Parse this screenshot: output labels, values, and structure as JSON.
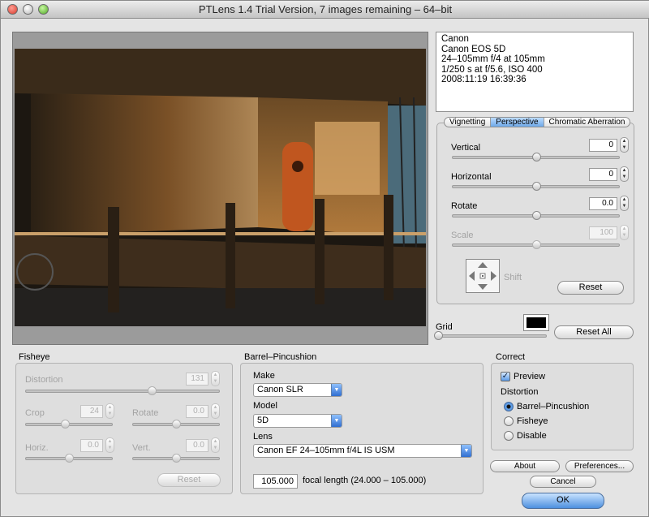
{
  "window": {
    "title": "PTLens 1.4 Trial Version, 7 images remaining – 64–bit"
  },
  "exif": [
    "Canon",
    "Canon EOS 5D",
    "24–105mm f/4 at 105mm",
    "1/250 s at f/5.6, ISO 400",
    "2008:11:19 16:39:36"
  ],
  "tabs": [
    {
      "label": "Vignetting",
      "active": false
    },
    {
      "label": "Perspective",
      "active": true
    },
    {
      "label": "Chromatic Aberration",
      "active": false
    }
  ],
  "perspective": {
    "vertical": {
      "label": "Vertical",
      "value": "0",
      "level": 0.5
    },
    "horizontal": {
      "label": "Horizontal",
      "value": "0",
      "level": 0.5
    },
    "rotate": {
      "label": "Rotate",
      "value": "0.0",
      "level": 0.5
    },
    "scale": {
      "label": "Scale",
      "value": "100",
      "level": 0.5
    },
    "shift_label": "Shift",
    "reset_label": "Reset"
  },
  "grid": {
    "label": "Grid",
    "level": 0.0,
    "color": "#000000"
  },
  "reset_all_label": "Reset All",
  "fisheye": {
    "title": "Fisheye",
    "distortion": {
      "label": "Distortion",
      "value": "131",
      "level": 0.65
    },
    "crop": {
      "label": "Crop",
      "value": "24",
      "level": 0.45
    },
    "rotate": {
      "label": "Rotate",
      "value": "0.0",
      "level": 0.5
    },
    "horiz": {
      "label": "Horiz.",
      "value": "0.0",
      "level": 0.5
    },
    "vert": {
      "label": "Vert.",
      "value": "0.0",
      "level": 0.5
    },
    "reset_label": "Reset"
  },
  "barrel": {
    "title": "Barrel–Pincushion",
    "make_label": "Make",
    "make_value": "Canon SLR",
    "model_label": "Model",
    "model_value": "5D",
    "lens_label": "Lens",
    "lens_value": "Canon EF 24–105mm f/4L IS USM",
    "focal_value": "105.000",
    "focal_label": "focal length (24.000 – 105.000)"
  },
  "correct": {
    "title": "Correct",
    "preview_label": "Preview",
    "distortion_label": "Distortion",
    "options": [
      "Barrel–Pincushion",
      "Fisheye",
      "Disable"
    ],
    "selected": 0
  },
  "buttons": {
    "about": "About",
    "preferences": "Preferences...",
    "cancel": "Cancel",
    "ok": "OK"
  },
  "colors": {
    "accent": "#4d90df",
    "window_bg": "#e4e4e4"
  }
}
